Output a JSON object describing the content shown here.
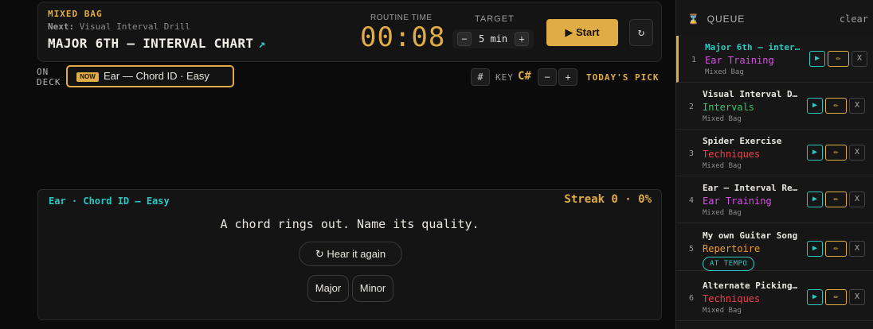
{
  "header": {
    "eyebrow": "MIXED BAG",
    "next_label": "Next:",
    "next_value": "Visual Interval Drill",
    "title": "MAJOR 6TH — INTERVAL CHART",
    "trend_icon": "↗",
    "routine_label": "ROUTINE TIME",
    "routine_time": "00:08",
    "target_label": "TARGET",
    "target_value": "5 min",
    "minus": "−",
    "plus": "+",
    "start_label": "▶ Start",
    "reset_icon": "↻"
  },
  "ondeck": {
    "label_line1": "ON",
    "label_line2": "DECK",
    "now_tag": "NOW",
    "text": "Ear — Chord ID · Easy"
  },
  "key": {
    "sharp_btn": "#",
    "label": "KEY",
    "value": "C#",
    "minus": "−",
    "plus": "+",
    "todays_pick": "TODAY'S PICK"
  },
  "card": {
    "heading": "Ear · Chord ID — Easy",
    "streak": "Streak 0 · 0%",
    "prompt": "A chord rings out. Name its quality.",
    "hear_label": "↻ Hear it again",
    "answers": [
      "Major",
      "Minor"
    ]
  },
  "queue": {
    "icon": "⌛",
    "title": "QUEUE",
    "clear": "clear",
    "buttons": {
      "play": "▶",
      "edit": "✏",
      "remove": "X"
    },
    "items": [
      {
        "num": "1",
        "title": "Major 6th — inter…",
        "category": "Ear Training",
        "cat_color": "#d84fe6",
        "sub": "Mixed Bag",
        "title_color": "#2cc7c0"
      },
      {
        "num": "2",
        "title": "Visual Interval D…",
        "category": "Intervals",
        "cat_color": "#36c46e",
        "sub": "Mixed Bag",
        "title_color": "#e8e6df"
      },
      {
        "num": "3",
        "title": "Spider Exercise",
        "category": "Techniques",
        "cat_color": "#e8434e",
        "sub": "Mixed Bag",
        "title_color": "#e8e6df"
      },
      {
        "num": "4",
        "title": "Ear — Interval Re…",
        "category": "Ear Training",
        "cat_color": "#d84fe6",
        "sub": "Mixed Bag",
        "title_color": "#e8e6df"
      },
      {
        "num": "5",
        "title": "My own Guitar Song",
        "category": "Repertoire",
        "cat_color": "#ef9a2e",
        "tag": "AT TEMPO",
        "title_color": "#e8e6df"
      },
      {
        "num": "6",
        "title": "Alternate Picking…",
        "category": "Techniques",
        "cat_color": "#e8434e",
        "sub": "Mixed Bag",
        "title_color": "#e8e6df"
      }
    ]
  }
}
